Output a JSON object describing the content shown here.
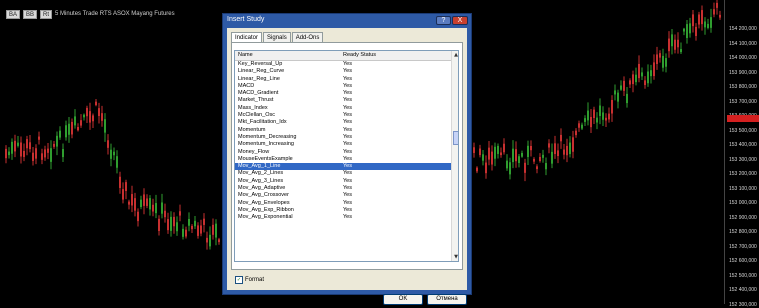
{
  "toolbar": {
    "btn1": "BA",
    "btn2": "BB",
    "btn3": "Rt",
    "info_text": "5 Minutes  Trade  RTS  ASOX Mayang  Futures"
  },
  "price_axis": {
    "labels": [
      "154 200,000",
      "154 100,000",
      "154 000,000",
      "153 900,000",
      "153 800,000",
      "153 700,000",
      "153 600,000",
      "153 500,000",
      "153 400,000",
      "153 300,000",
      "153 200,000",
      "153 100,000",
      "153 000,000",
      "152 900,000",
      "152 800,000",
      "152 700,000",
      "152 600,000",
      "152 500,000",
      "152 400,000",
      "152 300,000"
    ],
    "current_price_color": "#d42020"
  },
  "dialog": {
    "title": "Insert Study",
    "help_label": "?",
    "close_label": "X",
    "tabs": [
      {
        "label": "Indicator",
        "active": true
      },
      {
        "label": "Signals",
        "active": false
      },
      {
        "label": "Add-Ons",
        "active": false
      }
    ],
    "list": {
      "col_name": "Name",
      "col_status": "Ready Status",
      "rows": [
        {
          "name": "Key_Reversal_Up",
          "status": "Yes"
        },
        {
          "name": "Linear_Reg_Curve",
          "status": "Yes"
        },
        {
          "name": "Linear_Reg_Line",
          "status": "Yes"
        },
        {
          "name": "MACD",
          "status": "Yes"
        },
        {
          "name": "MACD_Gradient",
          "status": "Yes"
        },
        {
          "name": "Market_Thrust",
          "status": "Yes"
        },
        {
          "name": "Mass_Index",
          "status": "Yes"
        },
        {
          "name": "McClellan_Osc",
          "status": "Yes"
        },
        {
          "name": "Mkt_Facilitation_Idx",
          "status": "Yes"
        },
        {
          "name": "Momentum",
          "status": "Yes"
        },
        {
          "name": "Momentum_Decreasing",
          "status": "Yes"
        },
        {
          "name": "Momentum_Increasing",
          "status": "Yes"
        },
        {
          "name": "Money_Flow",
          "status": "Yes"
        },
        {
          "name": "MouseEventsExample",
          "status": "Yes"
        },
        {
          "name": "Mov_Avg_1_Line",
          "status": "Yes",
          "selected": true
        },
        {
          "name": "Mov_Avg_2_Lines",
          "status": "Yes"
        },
        {
          "name": "Mov_Avg_3_Lines",
          "status": "Yes"
        },
        {
          "name": "Mov_Avg_Adaptive",
          "status": "Yes"
        },
        {
          "name": "Mov_Avg_Crossover",
          "status": "Yes"
        },
        {
          "name": "Mov_Avg_Envelopes",
          "status": "Yes"
        },
        {
          "name": "Mov_Avg_Exp_Ribbon",
          "status": "Yes"
        },
        {
          "name": "Mov_Avg_Exponential",
          "status": "Yes"
        }
      ]
    },
    "format_label": "Format",
    "format_checked": true,
    "ok_label": "OK",
    "cancel_label": "Отмена"
  }
}
